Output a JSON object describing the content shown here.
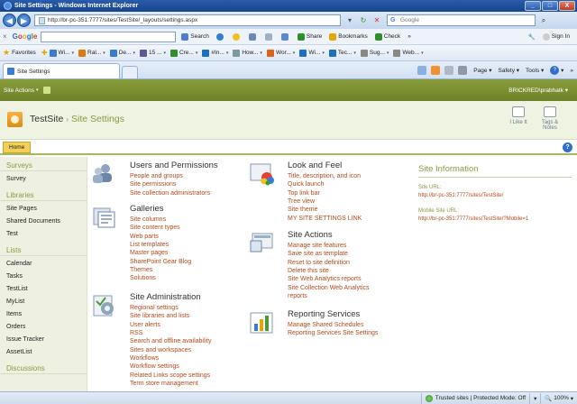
{
  "window": {
    "title": "Site Settings - Windows Internet Explorer",
    "min": "_",
    "max": "□",
    "close": "X"
  },
  "address": {
    "url": "http://br-pc-351:7777/sites/TestSite/_layouts/settings.aspx",
    "search_placeholder": "Google",
    "icons": [
      "back-icon",
      "forward-icon",
      "refresh-icon",
      "stop-icon",
      "search-icon"
    ]
  },
  "google_toolbar": {
    "logo": [
      "G",
      "o",
      "o",
      "g",
      "l",
      "e"
    ],
    "search_label": "Search",
    "share_label": "Share",
    "bookmarks_label": "Bookmarks",
    "check_label": "Check",
    "more": "»",
    "sign_in": "Sign In"
  },
  "favorites": {
    "label": "Favorites",
    "items": [
      "Wi...",
      "Ral...",
      "De...",
      "15 ...",
      "Cre...",
      "#In...",
      "How...",
      "Wor...",
      "Wi...",
      "Tec...",
      "Sug...",
      "Web..."
    ],
    "item_colors": [
      "#3a7bd5",
      "#e07a10",
      "#3a7bd5",
      "#5a5a9a",
      "#2f8f2a",
      "#1e6fc0",
      "#7a9aa0",
      "#e06020",
      "#1e6fc0",
      "#1e6fc0",
      "#888888",
      "#888888"
    ]
  },
  "tabbar": {
    "tab_title": "Site Settings",
    "page_label": "Page",
    "safety_label": "Safety",
    "tools_label": "Tools",
    "help_glyph": "?",
    "more": "»"
  },
  "sp_header": {
    "site_actions": "Site Actions",
    "user": "BRICKRED\\prabhatk"
  },
  "title_area": {
    "site_name": "TestSite",
    "arrow": "›",
    "page_name": "Site Settings",
    "like_label": "I Like It",
    "tags_label": "Tags &",
    "notes_label": "Notes"
  },
  "top_nav": {
    "home": "Home",
    "help": "?"
  },
  "quick_launch": {
    "surveys": {
      "heading": "Surveys",
      "items": [
        "Survey"
      ]
    },
    "libraries": {
      "heading": "Libraries",
      "items": [
        "Site Pages",
        "Shared Documents",
        "Test"
      ]
    },
    "lists": {
      "heading": "Lists",
      "items": [
        "Calendar",
        "Tasks",
        "TestList",
        "MyList",
        "Items",
        "Orders",
        "Issue Tracker",
        "AssetList"
      ]
    },
    "discussions": {
      "heading": "Discussions"
    }
  },
  "groups": {
    "users": {
      "title": "Users and Permissions",
      "links": [
        "People and groups",
        "Site permissions",
        "Site collection administrators"
      ]
    },
    "galleries": {
      "title": "Galleries",
      "links": [
        "Site columns",
        "Site content types",
        "Web parts",
        "List templates",
        "Master pages",
        "SharePoint Gear Blog",
        "Themes",
        "Solutions"
      ]
    },
    "admin": {
      "title": "Site Administration",
      "links": [
        "Regional settings",
        "Site libraries and lists",
        "User alerts",
        "RSS",
        "Search and offline availability",
        "Sites and workspaces",
        "Workflows",
        "Workflow settings",
        "Related Links scope settings",
        "Term store management"
      ]
    },
    "lookfeel": {
      "title": "Look and Feel",
      "links": [
        "Title, description, and icon",
        "Quick launch",
        "Top link bar",
        "Tree view",
        "Site theme",
        "MY SITE SETTINGS LINK"
      ]
    },
    "actions": {
      "title": "Site Actions",
      "links": [
        "Manage site features",
        "Save site as template",
        "Reset to site definition",
        "Delete this site",
        "Site Web Analytics reports",
        "Site Collection Web Analytics",
        "reports"
      ]
    },
    "reporting": {
      "title": "Reporting Services",
      "links": [
        "Manage Shared Schedules",
        "Reporting Services Site Settings"
      ]
    }
  },
  "site_info": {
    "title": "Site Information",
    "url_label": "Site URL:",
    "url_value": "http://br-pc-351:7777/sites/TestSite/",
    "mobile_label": "Mobile Site URL:",
    "mobile_value": "http://br-pc-351:7777/sites/TestSite/?Mobile=1"
  },
  "status": {
    "zone": "Trusted sites | Protected Mode: Off",
    "zoom": "100%"
  },
  "colors": {
    "sp_green": "#7a8f30",
    "link_orange": "#b5491d",
    "heading_green": "#8a9a40",
    "home_tab": "#f2cf55"
  }
}
